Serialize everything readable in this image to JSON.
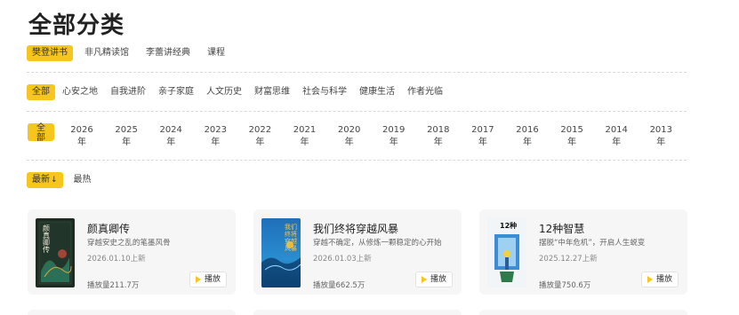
{
  "page": {
    "title": "全部分类"
  },
  "sources": [
    {
      "label": "樊登讲书",
      "active": true
    },
    {
      "label": "非凡精读馆",
      "active": false
    },
    {
      "label": "李蕾讲经典",
      "active": false
    },
    {
      "label": "课程",
      "active": false
    }
  ],
  "categories": [
    {
      "label": "全部",
      "active": true
    },
    {
      "label": "心安之地",
      "active": false
    },
    {
      "label": "自我进阶",
      "active": false
    },
    {
      "label": "亲子家庭",
      "active": false
    },
    {
      "label": "人文历史",
      "active": false
    },
    {
      "label": "财富思维",
      "active": false
    },
    {
      "label": "社会与科学",
      "active": false
    },
    {
      "label": "健康生活",
      "active": false
    },
    {
      "label": "作者光临",
      "active": false
    }
  ],
  "years": {
    "all": {
      "line1": "全",
      "line2": "部"
    },
    "items": [
      {
        "num": "2026",
        "unit": "年"
      },
      {
        "num": "2025",
        "unit": "年"
      },
      {
        "num": "2024",
        "unit": "年"
      },
      {
        "num": "2023",
        "unit": "年"
      },
      {
        "num": "2022",
        "unit": "年"
      },
      {
        "num": "2021",
        "unit": "年"
      },
      {
        "num": "2020",
        "unit": "年"
      },
      {
        "num": "2019",
        "unit": "年"
      },
      {
        "num": "2018",
        "unit": "年"
      },
      {
        "num": "2017",
        "unit": "年"
      },
      {
        "num": "2016",
        "unit": "年"
      },
      {
        "num": "2015",
        "unit": "年"
      },
      {
        "num": "2014",
        "unit": "年"
      },
      {
        "num": "2013",
        "unit": "年"
      }
    ]
  },
  "sort": {
    "latest": "最新",
    "latest_arrow": "↓",
    "hottest": "最热"
  },
  "cards": [
    {
      "title": "颜真卿传",
      "desc": "穿越安史之乱的笔墨风骨",
      "date": "2026.01.10上新",
      "plays": "播放量211.7万",
      "play_label": "播放",
      "cover_text": "颜真卿传"
    },
    {
      "title": "我们终将穿越风暴",
      "desc": "穿越不确定，从修炼一颗稳定的心开始",
      "date": "2026.01.03上新",
      "plays": "播放量662.5万",
      "play_label": "播放",
      "cover_text": "我们终将穿越风暴"
    },
    {
      "title": "12种智慧",
      "desc": "摆脱“中年危机”，开启人生蜕变",
      "date": "2025.12.27上新",
      "plays": "播放量750.6万",
      "play_label": "播放",
      "cover_text": "12种"
    }
  ],
  "colors": {
    "accent": "#f7c61c",
    "card_bg": "#f6f6f6"
  }
}
